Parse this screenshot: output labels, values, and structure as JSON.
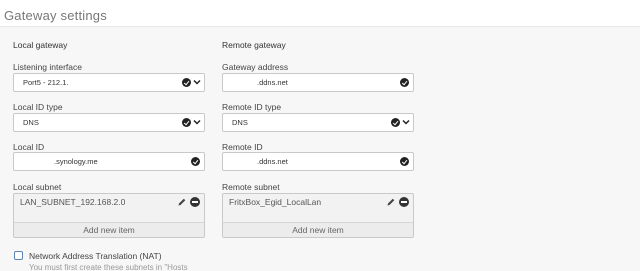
{
  "section": {
    "title": "Gateway settings"
  },
  "local": {
    "heading": "Local gateway",
    "listening_interface": {
      "label": "Listening interface",
      "value": "Port5 - 212.1."
    },
    "id_type": {
      "label": "Local ID type",
      "value": "DNS"
    },
    "id": {
      "label": "Local ID",
      "value": ".synology.me"
    },
    "subnet": {
      "label": "Local subnet",
      "items": [
        "LAN_SUBNET_192.168.2.0"
      ],
      "add_label": "Add new item"
    }
  },
  "remote": {
    "heading": "Remote gateway",
    "gateway_address": {
      "label": "Gateway address",
      "value": ".ddns.net"
    },
    "id_type": {
      "label": "Remote ID type",
      "value": "DNS"
    },
    "id": {
      "label": "Remote ID",
      "value": ".ddns.net"
    },
    "subnet": {
      "label": "Remote subnet",
      "items": [
        "FritxBox_Egid_LocalLan"
      ],
      "add_label": "Add new item"
    }
  },
  "nat": {
    "label": "Network Address Translation (NAT)",
    "checked": false,
    "note": "You must first create these subnets in \"Hosts"
  },
  "icons": {
    "field_ok": "check-circle-icon",
    "dropdown": "chevron-down-icon",
    "edit": "pencil-icon",
    "remove": "minus-circle-icon"
  }
}
